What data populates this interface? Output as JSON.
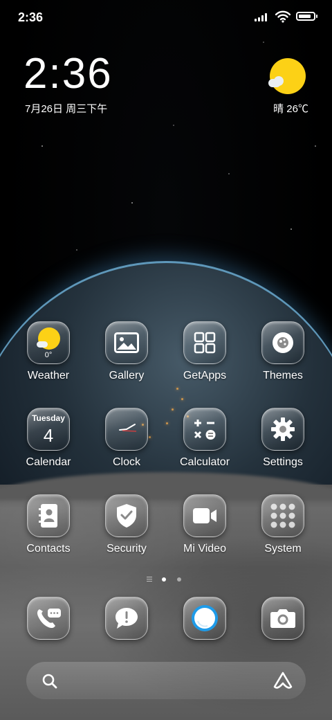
{
  "status_bar": {
    "time": "2:36",
    "battery_level": 0.85
  },
  "clock_widget": {
    "time": "2:36",
    "date": "7月26日 周三下午"
  },
  "weather_widget": {
    "text": "晴 26℃"
  },
  "apps": [
    {
      "label": "Weather",
      "icon": "weather-icon",
      "sub": "0°"
    },
    {
      "label": "Gallery",
      "icon": "gallery-icon"
    },
    {
      "label": "GetApps",
      "icon": "getapps-icon"
    },
    {
      "label": "Themes",
      "icon": "themes-icon"
    },
    {
      "label": "Calendar",
      "icon": "calendar-icon",
      "day": "Tuesday",
      "date": "4"
    },
    {
      "label": "Clock",
      "icon": "clock-icon"
    },
    {
      "label": "Calculator",
      "icon": "calculator-icon"
    },
    {
      "label": "Settings",
      "icon": "settings-icon"
    },
    {
      "label": "Contacts",
      "icon": "contacts-icon"
    },
    {
      "label": "Security",
      "icon": "security-icon"
    },
    {
      "label": "Mi Video",
      "icon": "video-icon"
    },
    {
      "label": "System",
      "icon": "folder-icon"
    }
  ],
  "dock": [
    {
      "icon": "phone-icon"
    },
    {
      "icon": "messages-icon"
    },
    {
      "icon": "browser-icon"
    },
    {
      "icon": "camera-icon"
    }
  ],
  "page_indicator": {
    "pages": 2,
    "current": 1
  },
  "colors": {
    "sun": "#fcd116",
    "atmosphere": "#78bee6",
    "browser_ring": "#1e9be9"
  }
}
